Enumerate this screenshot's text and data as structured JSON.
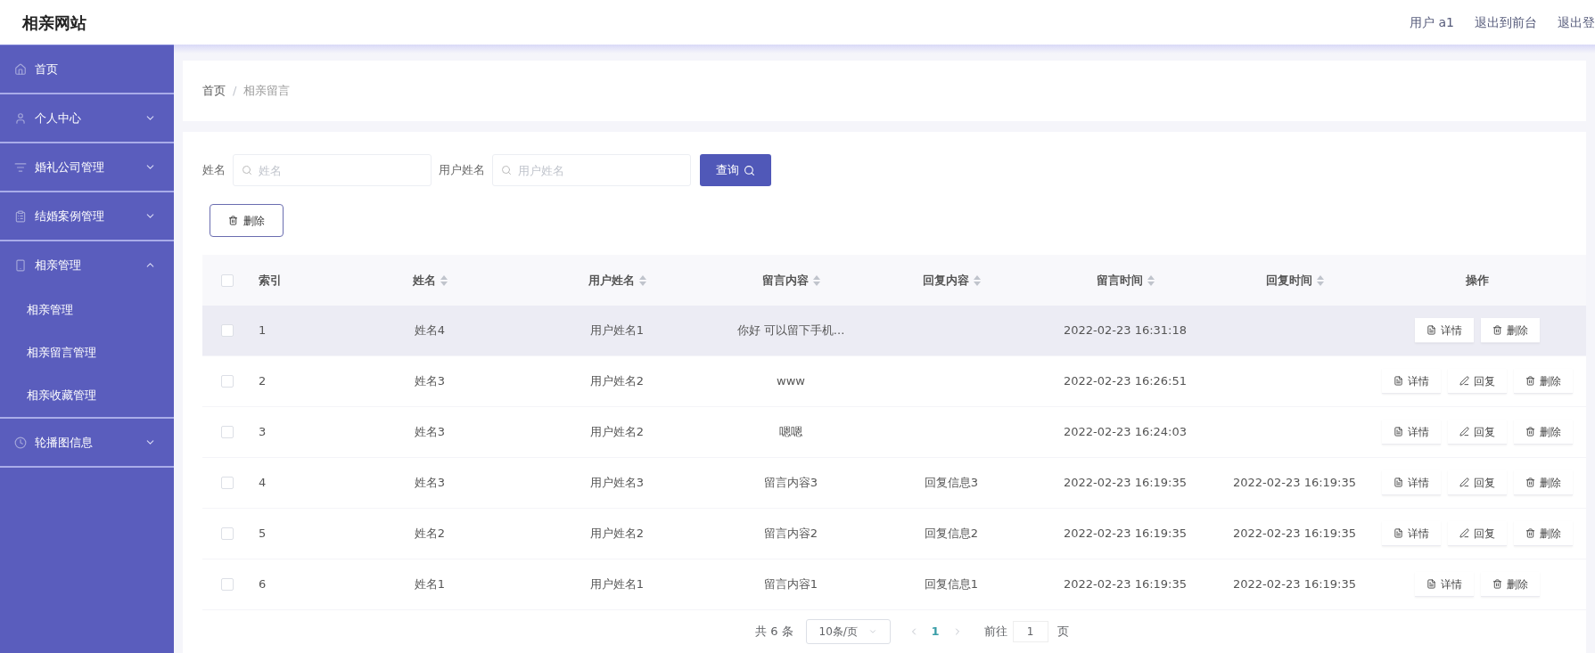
{
  "header": {
    "title": "相亲网站",
    "links": [
      "用户 a1",
      "退出到前台",
      "退出登"
    ]
  },
  "sidebar": {
    "items": [
      {
        "label": "首页",
        "kind": "link"
      },
      {
        "label": "个人中心",
        "kind": "menu",
        "expanded": false
      },
      {
        "label": "婚礼公司管理",
        "kind": "menu",
        "expanded": false
      },
      {
        "label": "结婚案例管理",
        "kind": "menu",
        "expanded": false
      },
      {
        "label": "相亲管理",
        "kind": "menu",
        "expanded": true,
        "children": [
          {
            "label": "相亲管理"
          },
          {
            "label": "相亲留言管理"
          },
          {
            "label": "相亲收藏管理"
          }
        ]
      },
      {
        "label": "轮播图信息",
        "kind": "menu",
        "expanded": false
      }
    ]
  },
  "breadcrumb": {
    "items": [
      "首页",
      "相亲留言"
    ],
    "separator": "/"
  },
  "search": {
    "fields": [
      {
        "label": "姓名",
        "placeholder": "姓名"
      },
      {
        "label": "用户姓名",
        "placeholder": "用户姓名"
      }
    ],
    "button": "查询"
  },
  "delete_button": "删除",
  "table": {
    "all_checked": false,
    "columns": [
      {
        "label": "索引",
        "kind": "plain"
      },
      {
        "label": "姓名",
        "kind": "sortable"
      },
      {
        "label": "用户姓名",
        "kind": "sortable"
      },
      {
        "label": "留言内容",
        "kind": "sortable"
      },
      {
        "label": "回复内容",
        "kind": "sortable"
      },
      {
        "label": "留言时间",
        "kind": "sortable"
      },
      {
        "label": "回复时间",
        "kind": "sortable"
      },
      {
        "label": "操作",
        "kind": "plain"
      }
    ],
    "rows": [
      {
        "hovered": true,
        "checked": false,
        "cells": [
          "1",
          "姓名4",
          "用户姓名1",
          "你好 可以留下手机...",
          "",
          "2022-02-23 16:31:18",
          ""
        ],
        "actions": [
          {
            "kind": "detail",
            "label": "详情"
          },
          {
            "kind": "delete",
            "label": "删除"
          }
        ]
      },
      {
        "hovered": false,
        "checked": false,
        "cells": [
          "2",
          "姓名3",
          "用户姓名2",
          "www",
          "",
          "2022-02-23 16:26:51",
          ""
        ],
        "actions": [
          {
            "kind": "detail",
            "label": "详情"
          },
          {
            "kind": "reply",
            "label": "回复"
          },
          {
            "kind": "delete",
            "label": "删除"
          }
        ]
      },
      {
        "hovered": false,
        "checked": false,
        "cells": [
          "3",
          "姓名3",
          "用户姓名2",
          "嗯嗯",
          "",
          "2022-02-23 16:24:03",
          ""
        ],
        "actions": [
          {
            "kind": "detail",
            "label": "详情"
          },
          {
            "kind": "reply",
            "label": "回复"
          },
          {
            "kind": "delete",
            "label": "删除"
          }
        ]
      },
      {
        "hovered": false,
        "checked": false,
        "cells": [
          "4",
          "姓名3",
          "用户姓名3",
          "留言内容3",
          "回复信息3",
          "2022-02-23 16:19:35",
          "2022-02-23 16:19:35"
        ],
        "actions": [
          {
            "kind": "detail",
            "label": "详情"
          },
          {
            "kind": "reply",
            "label": "回复"
          },
          {
            "kind": "delete",
            "label": "删除"
          }
        ]
      },
      {
        "hovered": false,
        "checked": false,
        "cells": [
          "5",
          "姓名2",
          "用户姓名2",
          "留言内容2",
          "回复信息2",
          "2022-02-23 16:19:35",
          "2022-02-23 16:19:35"
        ],
        "actions": [
          {
            "kind": "detail",
            "label": "详情"
          },
          {
            "kind": "reply",
            "label": "回复"
          },
          {
            "kind": "delete",
            "label": "删除"
          }
        ]
      },
      {
        "hovered": false,
        "checked": false,
        "cells": [
          "6",
          "姓名1",
          "用户姓名1",
          "留言内容1",
          "回复信息1",
          "2022-02-23 16:19:35",
          "2022-02-23 16:19:35"
        ],
        "actions": [
          {
            "kind": "detail",
            "label": "详情"
          },
          {
            "kind": "delete",
            "label": "删除"
          }
        ]
      }
    ]
  },
  "pagination": {
    "total": "共 6 条",
    "page_size": "10条/页",
    "pages": [
      {
        "label": "1",
        "selected": true
      }
    ],
    "goto_label": "前往",
    "goto_value": "1",
    "page_unit": "页"
  }
}
